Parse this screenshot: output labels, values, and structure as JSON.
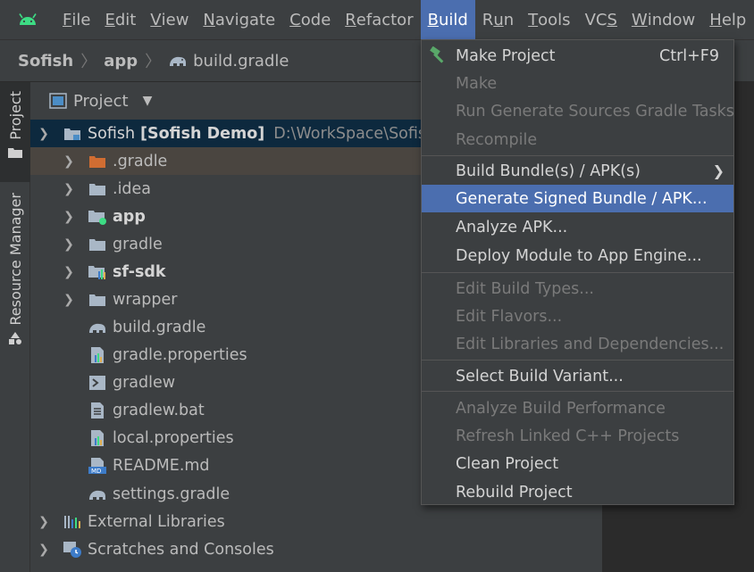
{
  "menubar": {
    "items": [
      {
        "label": "File",
        "mnemonic": "F",
        "rest": "ile"
      },
      {
        "label": "Edit",
        "mnemonic": "E",
        "rest": "dit"
      },
      {
        "label": "View",
        "mnemonic": "V",
        "rest": "iew"
      },
      {
        "label": "Navigate",
        "mnemonic": "N",
        "rest": "avigate"
      },
      {
        "label": "Code",
        "mnemonic": "C",
        "rest": "ode"
      },
      {
        "label": "Refactor",
        "mnemonic": "R",
        "rest": "efactor"
      },
      {
        "label": "Build",
        "mnemonic": "B",
        "rest": "uild"
      },
      {
        "label": "Run",
        "mnemonic": "u",
        "pre": "R",
        "rest": "n"
      },
      {
        "label": "Tools",
        "mnemonic": "T",
        "rest": "ools"
      },
      {
        "label": "VCS",
        "mnemonic": "S",
        "pre": "VC",
        "rest": ""
      },
      {
        "label": "Window",
        "mnemonic": "W",
        "rest": "indow"
      },
      {
        "label": "Help",
        "mnemonic": "H",
        "rest": "elp"
      }
    ],
    "active": "Build"
  },
  "breadcrumb": {
    "project": "Sofish",
    "module": "app",
    "file": "build.gradle"
  },
  "toolstrip": {
    "project_tab": "Project",
    "resource_tab": "Resource Manager"
  },
  "project_panel": {
    "view_label": "Project",
    "root": {
      "name": "Sofish",
      "module_label": "[Sofish Demo]",
      "path": "D:\\WorkSpace\\Sofish"
    },
    "items": [
      {
        "label": ".gradle",
        "icon": "folder-orange-icon",
        "arrow": true,
        "bold": false
      },
      {
        "label": ".idea",
        "icon": "folder-icon",
        "arrow": true,
        "bold": false
      },
      {
        "label": "app",
        "icon": "module-folder-icon",
        "arrow": true,
        "bold": true
      },
      {
        "label": "gradle",
        "icon": "folder-icon",
        "arrow": true,
        "bold": false
      },
      {
        "label": "sf-sdk",
        "icon": "library-module-icon",
        "arrow": true,
        "bold": true
      },
      {
        "label": "wrapper",
        "icon": "folder-icon",
        "arrow": true,
        "bold": false
      },
      {
        "label": "build.gradle",
        "icon": "gradle-elephant-icon",
        "arrow": false,
        "bold": false
      },
      {
        "label": "gradle.properties",
        "icon": "properties-file-icon",
        "arrow": false,
        "bold": false
      },
      {
        "label": "gradlew",
        "icon": "shell-script-icon",
        "arrow": false,
        "bold": false
      },
      {
        "label": "gradlew.bat",
        "icon": "text-file-icon",
        "arrow": false,
        "bold": false
      },
      {
        "label": "local.properties",
        "icon": "properties-file-icon",
        "arrow": false,
        "bold": false
      },
      {
        "label": "README.md",
        "icon": "markdown-file-icon",
        "arrow": false,
        "bold": false
      },
      {
        "label": "settings.gradle",
        "icon": "gradle-elephant-icon",
        "arrow": false,
        "bold": false
      }
    ],
    "bottom": [
      {
        "label": "External Libraries",
        "icon": "libraries-icon"
      },
      {
        "label": "Scratches and Consoles",
        "icon": "scratches-icon"
      }
    ]
  },
  "build_menu": {
    "items": [
      {
        "label": "Make Project",
        "shortcut": "Ctrl+F9",
        "enabled": true
      },
      {
        "label": "Make",
        "enabled": false
      },
      {
        "label": "Run Generate Sources Gradle Tasks",
        "enabled": false
      },
      {
        "label": "Recompile",
        "enabled": false
      },
      {
        "label": "Build Bundle(s) / APK(s)",
        "enabled": true,
        "submenu": true
      },
      {
        "label": "Generate Signed Bundle / APK...",
        "enabled": true,
        "highlighted": true
      },
      {
        "label": "Analyze APK...",
        "enabled": true
      },
      {
        "label": "Deploy Module to App Engine...",
        "enabled": true
      },
      {
        "label": "Edit Build Types...",
        "enabled": false
      },
      {
        "label": "Edit Flavors...",
        "enabled": false
      },
      {
        "label": "Edit Libraries and Dependencies...",
        "enabled": false
      },
      {
        "label": "Select Build Variant...",
        "enabled": true
      },
      {
        "label": "Analyze Build Performance",
        "enabled": false
      },
      {
        "label": "Refresh Linked C++ Projects",
        "enabled": false
      },
      {
        "label": "Clean Project",
        "enabled": true
      },
      {
        "label": "Rebuild Project",
        "enabled": true
      }
    ]
  },
  "colors": {
    "accent": "#4b6eaf",
    "android_green": "#3ddc84",
    "background": "#2b2b2b",
    "panel": "#3c3f41"
  }
}
